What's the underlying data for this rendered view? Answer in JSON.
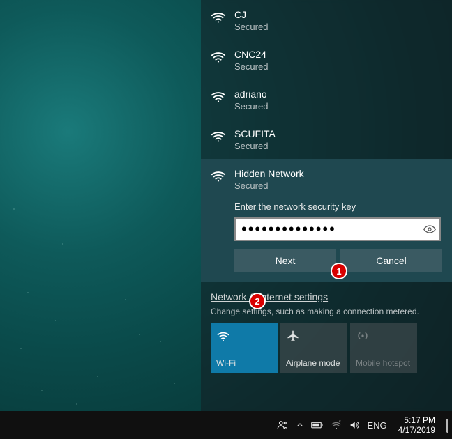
{
  "networks": [
    {
      "name": "CJ",
      "status": "Secured"
    },
    {
      "name": "CNC24",
      "status": "Secured"
    },
    {
      "name": "adriano",
      "status": "Secured"
    },
    {
      "name": "SCUFITA",
      "status": "Secured"
    }
  ],
  "selected": {
    "name": "Hidden Network",
    "status": "Secured",
    "prompt": "Enter the network security key",
    "password_masked": "••••••••••••••",
    "next_label": "Next",
    "cancel_label": "Cancel"
  },
  "settings": {
    "link": "Network & Internet settings",
    "desc": "Change settings, such as making a connection metered."
  },
  "tiles": {
    "wifi": "Wi-Fi",
    "airplane": "Airplane mode",
    "hotspot": "Mobile hotspot"
  },
  "taskbar": {
    "lang": "ENG",
    "time": "5:17 PM",
    "date": "4/17/2019"
  },
  "annotations": {
    "a1": "1",
    "a2": "2"
  }
}
